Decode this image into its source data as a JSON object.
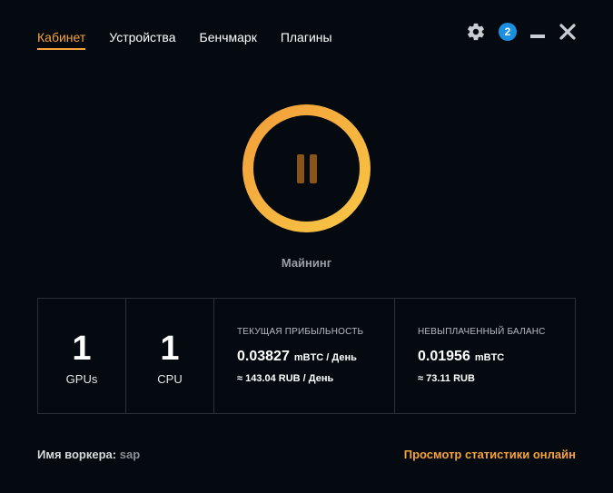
{
  "nav": {
    "items": [
      {
        "label": "Кабинет",
        "active": true
      },
      {
        "label": "Устройства",
        "active": false
      },
      {
        "label": "Бенчмарк",
        "active": false
      },
      {
        "label": "Плагины",
        "active": false
      }
    ]
  },
  "controls": {
    "settings_icon": "gear-icon",
    "notifications_count": "2",
    "minimize_icon": "minimize-icon",
    "close_icon": "close-icon"
  },
  "mining": {
    "state_icon": "pause-icon",
    "label": "Майнинг"
  },
  "stats": {
    "gpus": {
      "value": "1",
      "label": "GPUs"
    },
    "cpu": {
      "value": "1",
      "label": "CPU"
    },
    "profit": {
      "title": "ТЕКУЩАЯ ПРИБЫЛЬНОСТЬ",
      "value": "0.03827",
      "unit": "mBTC / День",
      "sub": "≈ 143.04 RUB / День"
    },
    "balance": {
      "title": "НЕВЫПЛАЧЕННЫЙ БАЛАНС",
      "value": "0.01956",
      "unit": "mBTC",
      "sub": "≈ 73.11 RUB"
    }
  },
  "footer": {
    "worker_label": "Имя воркера:",
    "worker_name": "sap",
    "stats_link": "Просмотр статистики онлайн"
  },
  "colors": {
    "background": "#040a10",
    "accent": "#f7a33b",
    "badge": "#1b8fe0",
    "border": "#2a3036"
  }
}
